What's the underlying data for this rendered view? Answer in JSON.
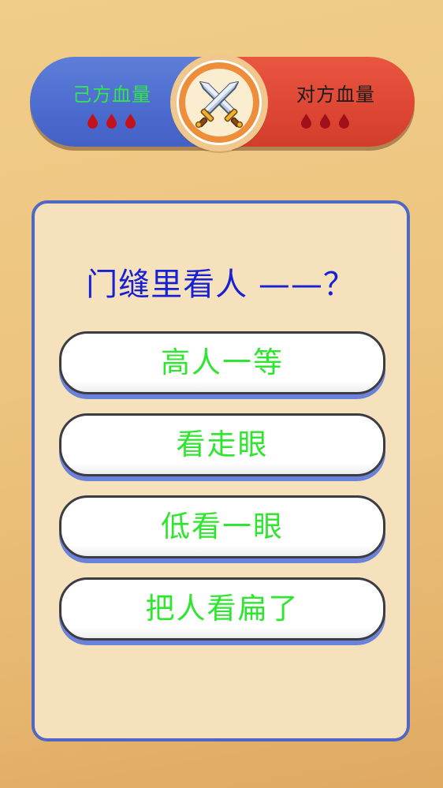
{
  "hud": {
    "self": {
      "label": "己方血量",
      "label_color": "#2ee84a",
      "lives": 3,
      "life_color": "#c4111e",
      "bar_color": "#4f6fd2"
    },
    "enemy": {
      "label": "对方血量",
      "label_color": "#1a1a1a",
      "lives": 3,
      "life_color": "#a0101a",
      "bar_color": "#dc4733"
    },
    "center_icon": "crossed-swords-icon"
  },
  "quiz": {
    "question": "门缝里看人 ——？",
    "question_color": "#1721d4",
    "option_text_color": "#2fe52f",
    "options": [
      {
        "label": "高人一等"
      },
      {
        "label": "看走眼"
      },
      {
        "label": "低看一眼"
      },
      {
        "label": "把人看扁了"
      }
    ]
  },
  "icons": {
    "life": "blood-drop-icon",
    "center": "crossed-swords-icon"
  }
}
